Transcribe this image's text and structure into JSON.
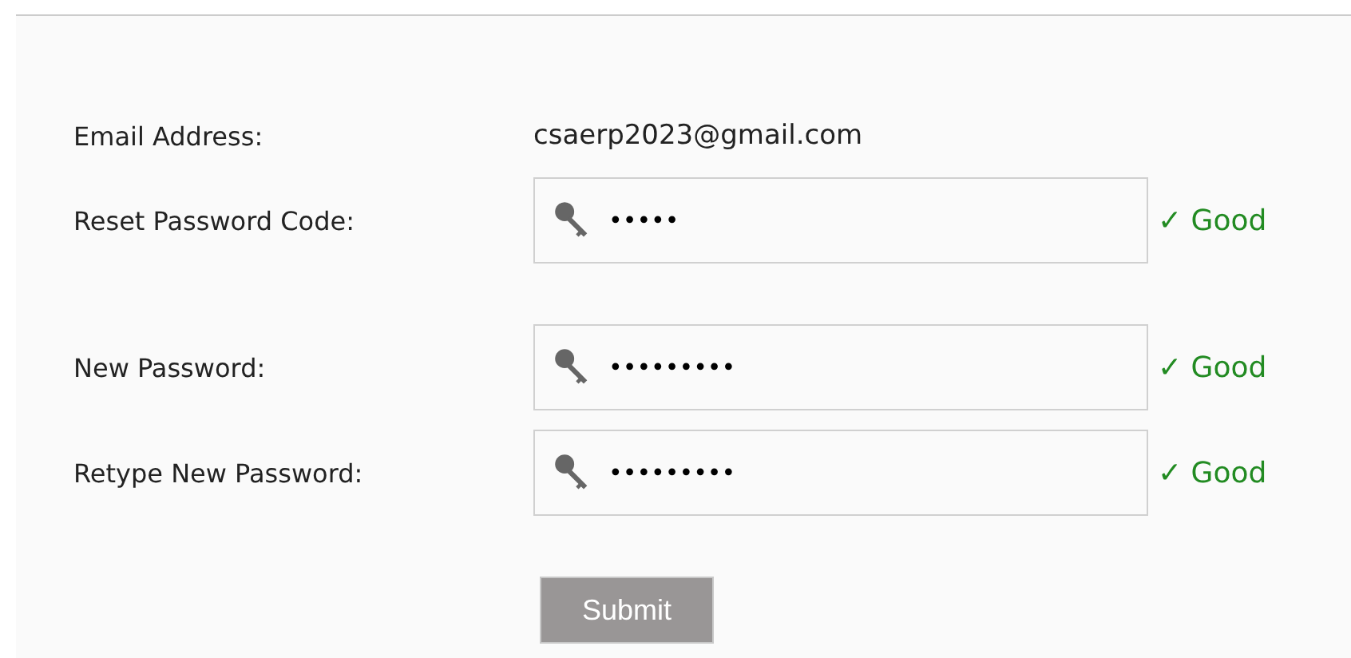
{
  "email": {
    "label": "Email Address:",
    "value": "csaerp2023@gmail.com"
  },
  "reset_code": {
    "label": "Reset Password Code:",
    "value": "•••••",
    "status": "✓ Good"
  },
  "new_password_fields": [
    {
      "label": "New Password:",
      "value": "•••••••••",
      "status": "✓ Good"
    },
    {
      "label": "Retype New Password:",
      "value": "•••••••••",
      "status": "✓ Good"
    }
  ],
  "submit": {
    "label": "Submit"
  }
}
